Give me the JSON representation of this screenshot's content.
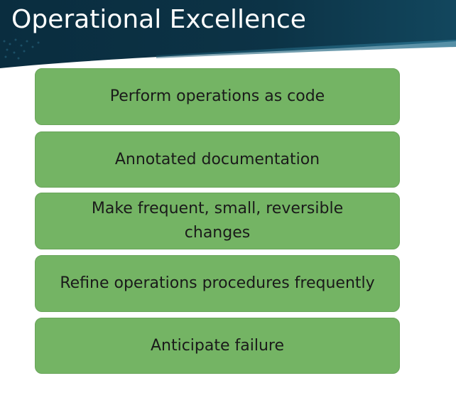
{
  "slide": {
    "title": "Operational Excellence",
    "items": [
      {
        "label": "Perform operations as code"
      },
      {
        "label": "Annotated documentation"
      },
      {
        "label": "Make frequent, small, reversible changes"
      },
      {
        "label": "Refine operations procedures frequently"
      },
      {
        "label": "Anticipate failure"
      }
    ]
  },
  "colors": {
    "header_dark": "#0c3346",
    "header_mid": "#12475e",
    "box_fill": "#74b464",
    "text": "#1a1a1a",
    "title_text": "#ffffff"
  }
}
